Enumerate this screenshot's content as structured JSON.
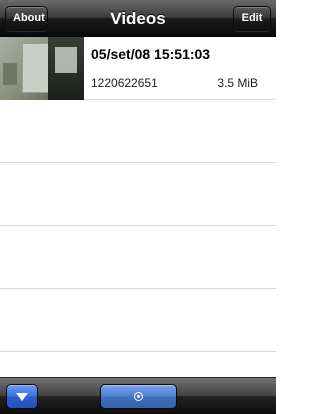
{
  "navbar": {
    "title": "Videos",
    "left_button": "About",
    "right_button": "Edit"
  },
  "videos": [
    {
      "date": "05/set/08 15:51:03",
      "id": "1220622651",
      "size": "3.5 MiB"
    }
  ],
  "toolbar": {
    "left_icon": "down-arrow-icon",
    "center_icon": "record-icon"
  },
  "colors": {
    "bar_dark": "#0a0a0a",
    "button_blue": "#3a72df",
    "separator": "#d8d8d8"
  }
}
